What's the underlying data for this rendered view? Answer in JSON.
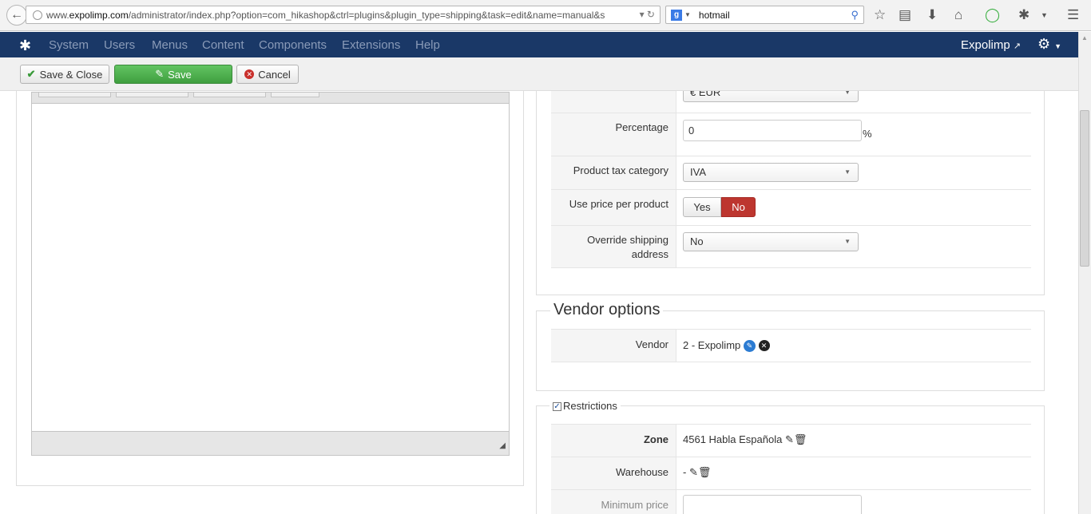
{
  "browser": {
    "url_prefix": "www.",
    "url_domain": "expolimp.com",
    "url_path": "/administrator/index.php?option=com_hikashop&ctrl=plugins&plugin_type=shipping&task=edit&name=manual&s",
    "search_query": "hotmail",
    "search_engine": "g",
    "icons": [
      "back-icon",
      "globe-icon",
      "reload-icon",
      "search-icon",
      "star-icon",
      "reading-list-icon",
      "download-icon",
      "home-icon",
      "sync-icon",
      "addon-icon",
      "menu-icon"
    ]
  },
  "admin_menu": {
    "items": [
      "System",
      "Users",
      "Menus",
      "Content",
      "Components",
      "Extensions",
      "Help"
    ],
    "site_name": "Expolimp"
  },
  "toolbar": {
    "save_close_label": "Save & Close",
    "save_label": "Save",
    "cancel_label": "Cancel"
  },
  "shipping_params": {
    "currency": "€ EUR",
    "percentage_label": "Percentage",
    "percentage_value": "0",
    "percentage_unit": "%",
    "tax_category_label": "Product tax category",
    "tax_category_value": "IVA",
    "price_per_product_label": "Use price per product",
    "yes_label": "Yes",
    "no_label": "No",
    "override_label_line1": "Override shipping",
    "override_label_line2": "address",
    "override_value": "No"
  },
  "vendor": {
    "legend": "Vendor options",
    "label": "Vendor",
    "value": "2 - Expolimp"
  },
  "restrictions": {
    "legend": "Restrictions",
    "checked": true,
    "zone_label": "Zone",
    "zone_value": "4561 Habla Española",
    "warehouse_label": "Warehouse",
    "warehouse_value": "-",
    "min_price_label": "Minimum price"
  },
  "colors": {
    "admin_bar": "#1a3867",
    "save_green": "#4cae4c",
    "no_red": "#bd362f"
  }
}
